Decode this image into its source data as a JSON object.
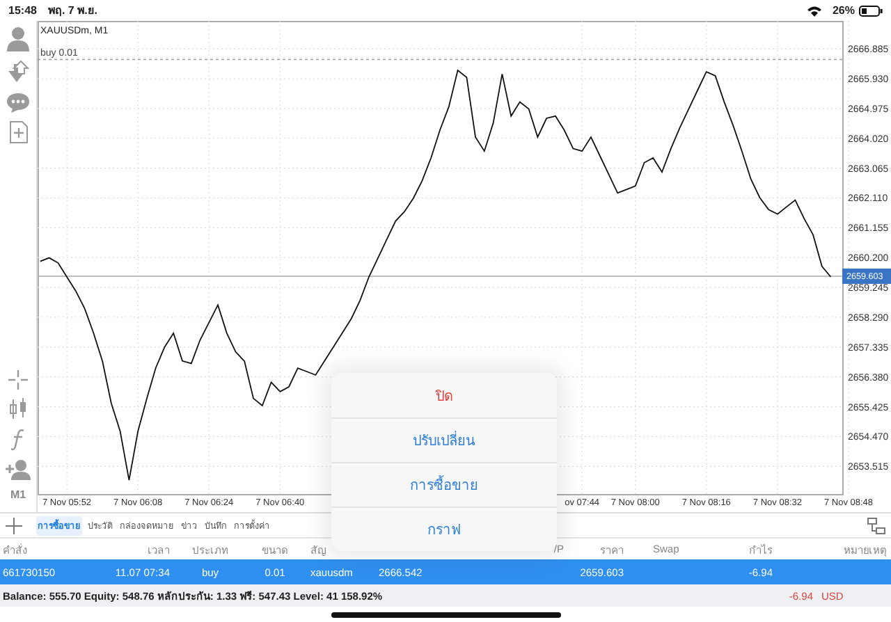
{
  "status_bar": {
    "time": "15:48",
    "date": "พฤ. 7 พ.ย.",
    "battery": "26%"
  },
  "toolbar": {
    "timeframe": "M1"
  },
  "chart": {
    "title": "XAUUSDm, M1",
    "chart_data": {
      "type": "line",
      "ylim": [
        2652.63,
        2667.78
      ],
      "categories": [
        null,
        null,
        null,
        "7 Nov 05:52",
        null,
        null,
        null,
        null,
        null,
        null,
        null,
        "7 Nov 06:08",
        null,
        null,
        null,
        null,
        null,
        null,
        null,
        "7 Nov 06:24",
        null,
        null,
        null,
        null,
        null,
        null,
        null,
        "7 Nov 06:40",
        null,
        null,
        null,
        null,
        null,
        null,
        null,
        null,
        null,
        null,
        null,
        null,
        null,
        null,
        null,
        null,
        null,
        null,
        null,
        null,
        null,
        null,
        null,
        null,
        null,
        null,
        null,
        null,
        null,
        null,
        null,
        null,
        null,
        "ov 07:44",
        null,
        null,
        null,
        null,
        null,
        "7 Nov 08:00",
        null,
        null,
        null,
        null,
        null,
        null,
        null,
        "7 Nov 08:16",
        null,
        null,
        null,
        null,
        null,
        null,
        null,
        "7 Nov 08:32",
        null,
        null,
        null,
        null,
        null,
        null,
        null,
        "7 Nov 08:48"
      ],
      "series": [
        {
          "color": "#111111",
          "values": [
            2660.08,
            2660.19,
            2660.03,
            2659.58,
            2659.13,
            2658.57,
            2657.78,
            2656.88,
            2655.54,
            2654.64,
            2653.07,
            2654.64,
            2655.69,
            2656.66,
            2657.33,
            2657.78,
            2656.89,
            2656.81,
            2657.56,
            2658.12,
            2658.68,
            2657.78,
            2657.18,
            2656.88,
            2655.69,
            2655.46,
            2656.21,
            2655.91,
            2656.06,
            2656.66,
            2656.55,
            2656.44,
            2656.89,
            2657.33,
            2657.78,
            2658.23,
            2658.83,
            2659.58,
            2660.17,
            2660.77,
            2661.37,
            2661.67,
            2662.1,
            2662.66,
            2663.39,
            2664.28,
            2665.03,
            2666.2,
            2665.97,
            2664.06,
            2663.61,
            2664.51,
            2666.08,
            2664.73,
            2665.18,
            2664.96,
            2664.06,
            2664.66,
            2664.73,
            2664.28,
            2663.69,
            2663.61,
            2664.06,
            2663.46,
            2662.87,
            2662.27,
            2662.38,
            2662.49,
            2663.24,
            2663.39,
            2662.94,
            2663.69,
            2664.36,
            2664.96,
            2665.55,
            2666.15,
            2666.02,
            2665.18,
            2664.43,
            2663.61,
            2662.72,
            2662.12,
            2661.74,
            2661.59,
            2661.82,
            2662.04,
            2661.45,
            2660.93,
            2659.92,
            2659.58,
            null,
            null
          ]
        }
      ],
      "yticks": [
        {
          "value": 2666.885,
          "label": "2666.885"
        },
        {
          "value": 2665.93,
          "label": "2665.930"
        },
        {
          "value": 2664.975,
          "label": "2664.975"
        },
        {
          "value": 2664.02,
          "label": "2664.020"
        },
        {
          "value": 2663.065,
          "label": "2663.065"
        },
        {
          "value": 2662.11,
          "label": "2662.110"
        },
        {
          "value": 2661.155,
          "label": "2661.155"
        },
        {
          "value": 2660.2,
          "label": "2660.200"
        },
        {
          "value": 2659.245,
          "label": "2659.245"
        },
        {
          "value": 2658.29,
          "label": "2658.290"
        },
        {
          "value": 2657.335,
          "label": "2657.335"
        },
        {
          "value": 2656.38,
          "label": "2656.380"
        },
        {
          "value": 2655.425,
          "label": "2655.425"
        },
        {
          "value": 2654.47,
          "label": "2654.470"
        },
        {
          "value": 2653.515,
          "label": "2653.515"
        }
      ],
      "grid": true,
      "ref_lines": [
        {
          "axis": "y",
          "value": 2666.542,
          "label": "buy 0.01"
        },
        {
          "axis": "y",
          "value": 2659.603,
          "label": "2659.603"
        }
      ]
    }
  },
  "tabs": [
    {
      "label": "การซื้อขาย",
      "selected": true
    },
    {
      "label": "ประวัติ",
      "selected": false
    },
    {
      "label": "กล่องจดหมาย",
      "selected": false
    },
    {
      "label": "ข่าว",
      "selected": false
    },
    {
      "label": "บันทึก",
      "selected": false
    },
    {
      "label": "การตั้งค่า",
      "selected": false
    }
  ],
  "table": {
    "columns": [
      {
        "label": "คำสั่ง"
      },
      {
        "label": "เวลา"
      },
      {
        "label": "ประเภท"
      },
      {
        "label": "ขนาด"
      },
      {
        "label": "สัญ"
      },
      {},
      {},
      {
        "label": "/P"
      },
      {
        "label": "ราคา"
      },
      {
        "label": "Swap"
      },
      {
        "label": "กำไร"
      },
      {
        "label": "หมายเหตุ"
      }
    ],
    "rows": [
      {
        "selected": true,
        "cells": [
          "661730150",
          "11.07 07:34",
          "buy",
          "0.01",
          "xauusdm",
          "2666.542",
          "",
          "",
          "2659.603",
          "",
          "-6.94",
          ""
        ]
      }
    ]
  },
  "summary": {
    "text": "Balance: 555.70 Equity: 548.76 หลักประกัน: 1.33 ฟรี: 547.43 Level: 41 158.92%",
    "profit": "-6.94",
    "currency": "USD"
  },
  "popup_menu": {
    "items": [
      {
        "label": "ปิด",
        "kind": "destructive"
      },
      {
        "label": "ปรับเปลี่ยน",
        "kind": "default"
      },
      {
        "label": "การซื้อขาย",
        "kind": "default"
      },
      {
        "label": "กราฟ",
        "kind": "default"
      }
    ]
  }
}
